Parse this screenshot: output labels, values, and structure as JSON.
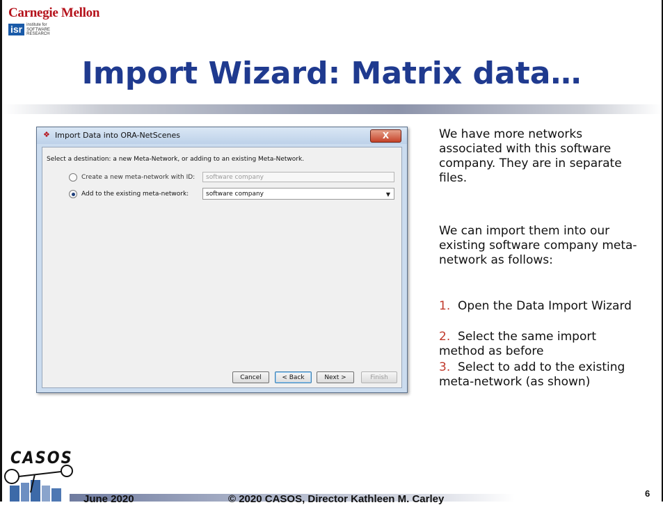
{
  "header": {
    "university": "Carnegie Mellon",
    "isr_logo": "isr",
    "isr_text_line1": "institute for",
    "isr_text_line2": "SOFTWARE",
    "isr_text_line3": "RESEARCH",
    "title": "Import Wizard: Matrix data…"
  },
  "dialog": {
    "title": "Import Data into ORA-NetScenes",
    "close_label": "X",
    "instruction": "Select a destination: a new Meta-Network, or adding to an existing Meta-Network.",
    "option_new_label": "Create a new meta-network with ID:",
    "option_new_value": "software company",
    "option_existing_label": "Add to the existing meta-network:",
    "option_existing_value": "software company",
    "selected_option": "existing",
    "buttons": {
      "cancel": "Cancel",
      "back": "< Back",
      "next": "Next >",
      "finish": "Finish"
    }
  },
  "notes": {
    "p1": "We have more networks associated with this software company.  They are in separate files.",
    "p2": "We can import them into our existing software company meta-network as follows:",
    "steps": [
      {
        "num": "1.",
        "text": "Open the Data Import Wizard"
      },
      {
        "num": "2.",
        "text": "Select the same import method as before"
      },
      {
        "num": "3.",
        "text": "Select to add to the existing meta-network (as shown)"
      }
    ]
  },
  "footer": {
    "logo": "CASOS",
    "date": "June 2020",
    "copyright": "© 2020 CASOS, Director Kathleen M. Carley",
    "page": "6"
  },
  "colors": {
    "title": "#1f3a8f",
    "cmu_red": "#b5121b",
    "step_number": "#c0392b"
  }
}
